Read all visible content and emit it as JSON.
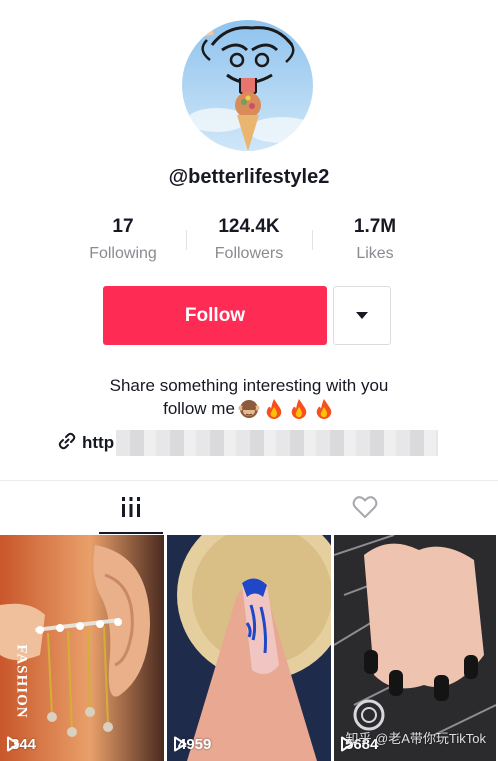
{
  "profile": {
    "username": "@betterlifestyle2",
    "bio_line1": "Share something interesting with you",
    "bio_line2": "follow me",
    "bio_emojis": [
      "see-no-evil-monkey-icon",
      "fire-icon",
      "fire-icon",
      "fire-icon"
    ],
    "link_prefix": "http"
  },
  "stats": [
    {
      "value": "17",
      "label": "Following"
    },
    {
      "value": "124.4K",
      "label": "Followers"
    },
    {
      "value": "1.7M",
      "label": "Likes"
    }
  ],
  "actions": {
    "follow_label": "Follow",
    "more_icon": "caret-down-icon"
  },
  "tabs": {
    "videos_icon": "grid-bars-icon",
    "liked_icon": "heart-outline-icon"
  },
  "videos": [
    {
      "views": "344",
      "overlay_text": "FASHION"
    },
    {
      "views": "4959"
    },
    {
      "views": "5684"
    }
  ],
  "watermark": "知乎 @老A带你玩TikTok",
  "colors": {
    "accent": "#fe2c55",
    "text": "#161823",
    "muted": "#8a8b91"
  }
}
